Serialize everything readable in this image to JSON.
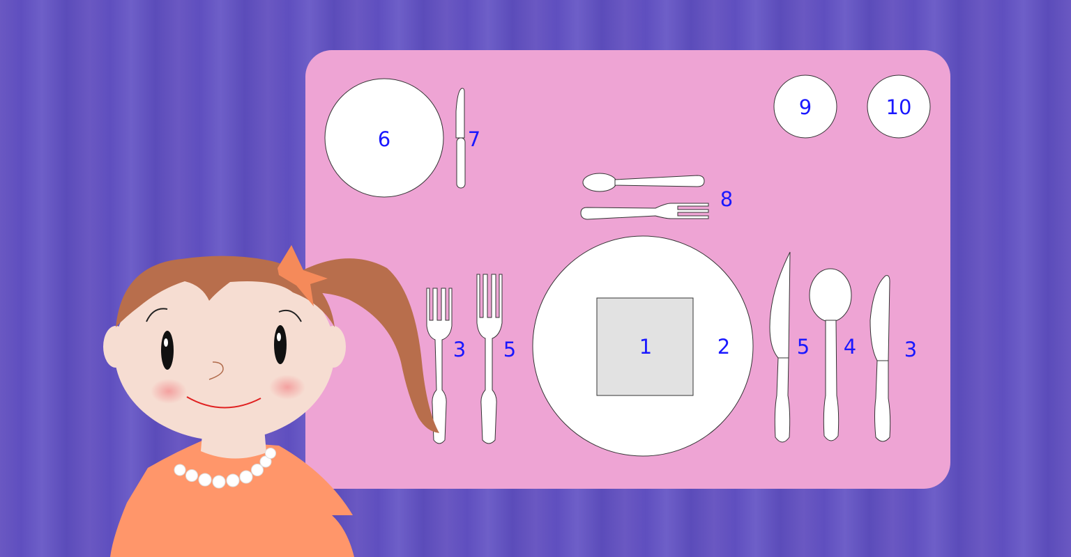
{
  "colors": {
    "background": "#6354c0",
    "placemat": "#eea4d4",
    "label": "#1a18ff",
    "plate_fill": "#ffffff",
    "napkin_fill": "#e2e2e2",
    "outline": "#3a3a3a",
    "skin": "#f6ddd2",
    "hair": "#b86e4c",
    "dress": "#ff966a",
    "bow": "#f58a5a",
    "pearl": "#ffffff",
    "cheek": "#f4a6a6",
    "mouth": "#e02020"
  },
  "labels": {
    "napkin": "1",
    "dinner_plate": "2",
    "salad_fork": "3",
    "dinner_fork": "5",
    "dinner_knife": "5",
    "soup_spoon": "4",
    "salad_knife": "3",
    "bread_plate": "6",
    "butter_knife": "7",
    "dessert_utensils": "8",
    "water_glass": "9",
    "wine_glass": "10"
  }
}
